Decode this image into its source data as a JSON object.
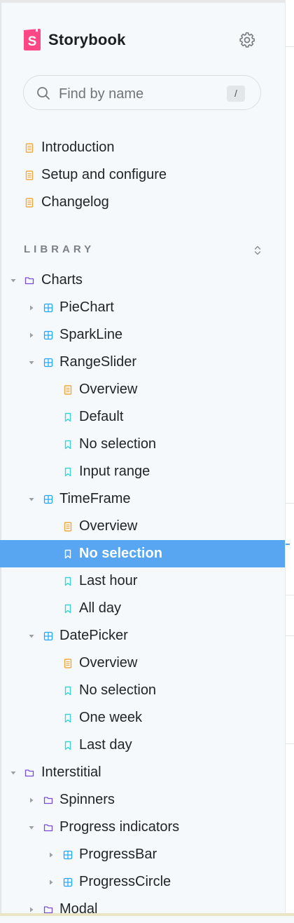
{
  "brand": {
    "name": "Storybook",
    "accent": "#ff4785"
  },
  "search": {
    "placeholder": "Find by name",
    "shortcut": "/"
  },
  "docs": [
    {
      "label": "Introduction"
    },
    {
      "label": "Setup and configure"
    },
    {
      "label": "Changelog"
    }
  ],
  "library": {
    "title": "LIBRARY"
  },
  "tree": [
    {
      "label": "Charts",
      "kind": "folder",
      "level": 0,
      "expanded": true
    },
    {
      "label": "PieChart",
      "kind": "component",
      "level": 1,
      "expanded": false
    },
    {
      "label": "SparkLine",
      "kind": "component",
      "level": 1,
      "expanded": false
    },
    {
      "label": "RangeSlider",
      "kind": "component",
      "level": 1,
      "expanded": true
    },
    {
      "label": "Overview",
      "kind": "doc",
      "level": 2
    },
    {
      "label": "Default",
      "kind": "story",
      "level": 2
    },
    {
      "label": "No selection",
      "kind": "story",
      "level": 2
    },
    {
      "label": "Input range",
      "kind": "story",
      "level": 2
    },
    {
      "label": "TimeFrame",
      "kind": "component",
      "level": 1,
      "expanded": true
    },
    {
      "label": "Overview",
      "kind": "doc",
      "level": 2
    },
    {
      "label": "No selection",
      "kind": "story",
      "level": 2,
      "selected": true
    },
    {
      "label": "Last hour",
      "kind": "story",
      "level": 2
    },
    {
      "label": "All day",
      "kind": "story",
      "level": 2
    },
    {
      "label": "DatePicker",
      "kind": "component",
      "level": 1,
      "expanded": true
    },
    {
      "label": "Overview",
      "kind": "doc",
      "level": 2
    },
    {
      "label": "No selection",
      "kind": "story",
      "level": 2
    },
    {
      "label": "One week",
      "kind": "story",
      "level": 2
    },
    {
      "label": "Last day",
      "kind": "story",
      "level": 2
    },
    {
      "label": "Interstitial",
      "kind": "folder",
      "level": 0,
      "expanded": true
    },
    {
      "label": "Spinners",
      "kind": "folder",
      "level": 1,
      "expanded": false
    },
    {
      "label": "Progress indicators",
      "kind": "folder",
      "level": 1,
      "expanded": true
    },
    {
      "label": "ProgressBar",
      "kind": "component",
      "level": 2,
      "expanded": false
    },
    {
      "label": "ProgressCircle",
      "kind": "component",
      "level": 2,
      "expanded": false
    },
    {
      "label": "Modal",
      "kind": "folder",
      "level": 1,
      "expanded": false
    }
  ],
  "colors": {
    "doc": "#f0a93c",
    "story": "#37d5d3",
    "component": "#1ea7fd",
    "folder": "#774dd7",
    "selected": "#58a6f2"
  }
}
